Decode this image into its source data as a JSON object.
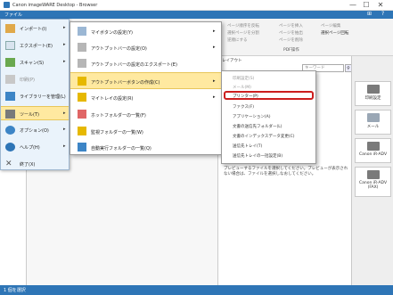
{
  "window": {
    "title": "Canon imageWARE Desktop - Browser",
    "minimize": "—",
    "maximize": "☐",
    "close": "✕"
  },
  "ribbon_bar": {
    "file_label": "ファイル",
    "icon_a": "⊞",
    "help": "?"
  },
  "ribbon": {
    "items": [
      "ページ順序を反転",
      "選択ページを分割",
      "逆順にする",
      "ページを挿入",
      "ページを抽出",
      "ページを削除",
      "ページ編集",
      "選択ページ回転"
    ],
    "group_pdf": "PDF操作",
    "layout_label": "レイアウト",
    "search_placeholder": "キーワード"
  },
  "file_menu": {
    "items": [
      {
        "label": "インポート(I)",
        "icon": "import-icon",
        "arrow": "▸"
      },
      {
        "label": "エクスポート(E)",
        "icon": "export-icon",
        "arrow": "▸"
      },
      {
        "label": "スキャン(S)",
        "icon": "scan-icon",
        "arrow": "▸"
      },
      {
        "label": "印刷(P)",
        "icon": "print-icon",
        "arrow": ""
      },
      {
        "label": "ライブラリーを管理(L)",
        "icon": "library-icon",
        "arrow": ""
      },
      {
        "label": "ツール(T)",
        "icon": "tool-icon",
        "arrow": "▸"
      },
      {
        "label": "オプション(O)",
        "icon": "option-icon",
        "arrow": "▸"
      },
      {
        "label": "ヘルプ(H)",
        "icon": "help-icon",
        "arrow": "▸"
      },
      {
        "label": "終了(X)",
        "icon": "exit-icon",
        "arrow": ""
      }
    ]
  },
  "tools_submenu": {
    "items": [
      {
        "label": "マイボタンの設定(Y)",
        "arrow": "▸"
      },
      {
        "label": "アウトプットバーの設定(O)",
        "arrow": "▸"
      },
      {
        "label": "アウトプットバーの設定のエクスポート(E)",
        "arrow": ""
      },
      {
        "label": "アウトプットバーボタンの作成(C)",
        "arrow": "▸"
      },
      {
        "label": "マイトレイの設定(R)",
        "arrow": "▸"
      },
      {
        "label": "ホットフォルダーの一覧(F)",
        "arrow": ""
      },
      {
        "label": "監視フォルダーの一覧(W)",
        "arrow": ""
      },
      {
        "label": "自動実行フォルダーの一覧(Q)",
        "arrow": ""
      }
    ]
  },
  "create_submenu": {
    "items": [
      {
        "label": "印刷設定(S)",
        "disabled": true
      },
      {
        "label": "メール(M)",
        "disabled": true
      },
      {
        "label": "プリンター(P)",
        "disabled": false
      },
      {
        "label": "ファクス(F)",
        "disabled": false
      },
      {
        "label": "アプリケーション(A)",
        "disabled": false
      },
      {
        "label": "文書の送信先フォルダー(L)",
        "disabled": false
      },
      {
        "label": "文書のインデックスデータ変更(C)",
        "disabled": false
      },
      {
        "label": "送信先トレイ(T)",
        "disabled": false
      },
      {
        "label": "送信先トレイの一括設定(B)",
        "disabled": false
      }
    ]
  },
  "browser_message": "プレビューするファイルを選択してください。プレビューが表示されない場合は、ファイルを選択しなおしてください。",
  "output_bar": {
    "buttons": [
      {
        "label": "印刷設定"
      },
      {
        "label": "メール"
      },
      {
        "label": "Canon iR-ADV"
      },
      {
        "label": "Canon iR-ADV (FAX)"
      }
    ]
  },
  "status": {
    "text": "1 個を選択"
  },
  "colors": {
    "accent": "#2e75b6",
    "highlight": "#ffe9a0",
    "outline": "#cc1f1f"
  }
}
